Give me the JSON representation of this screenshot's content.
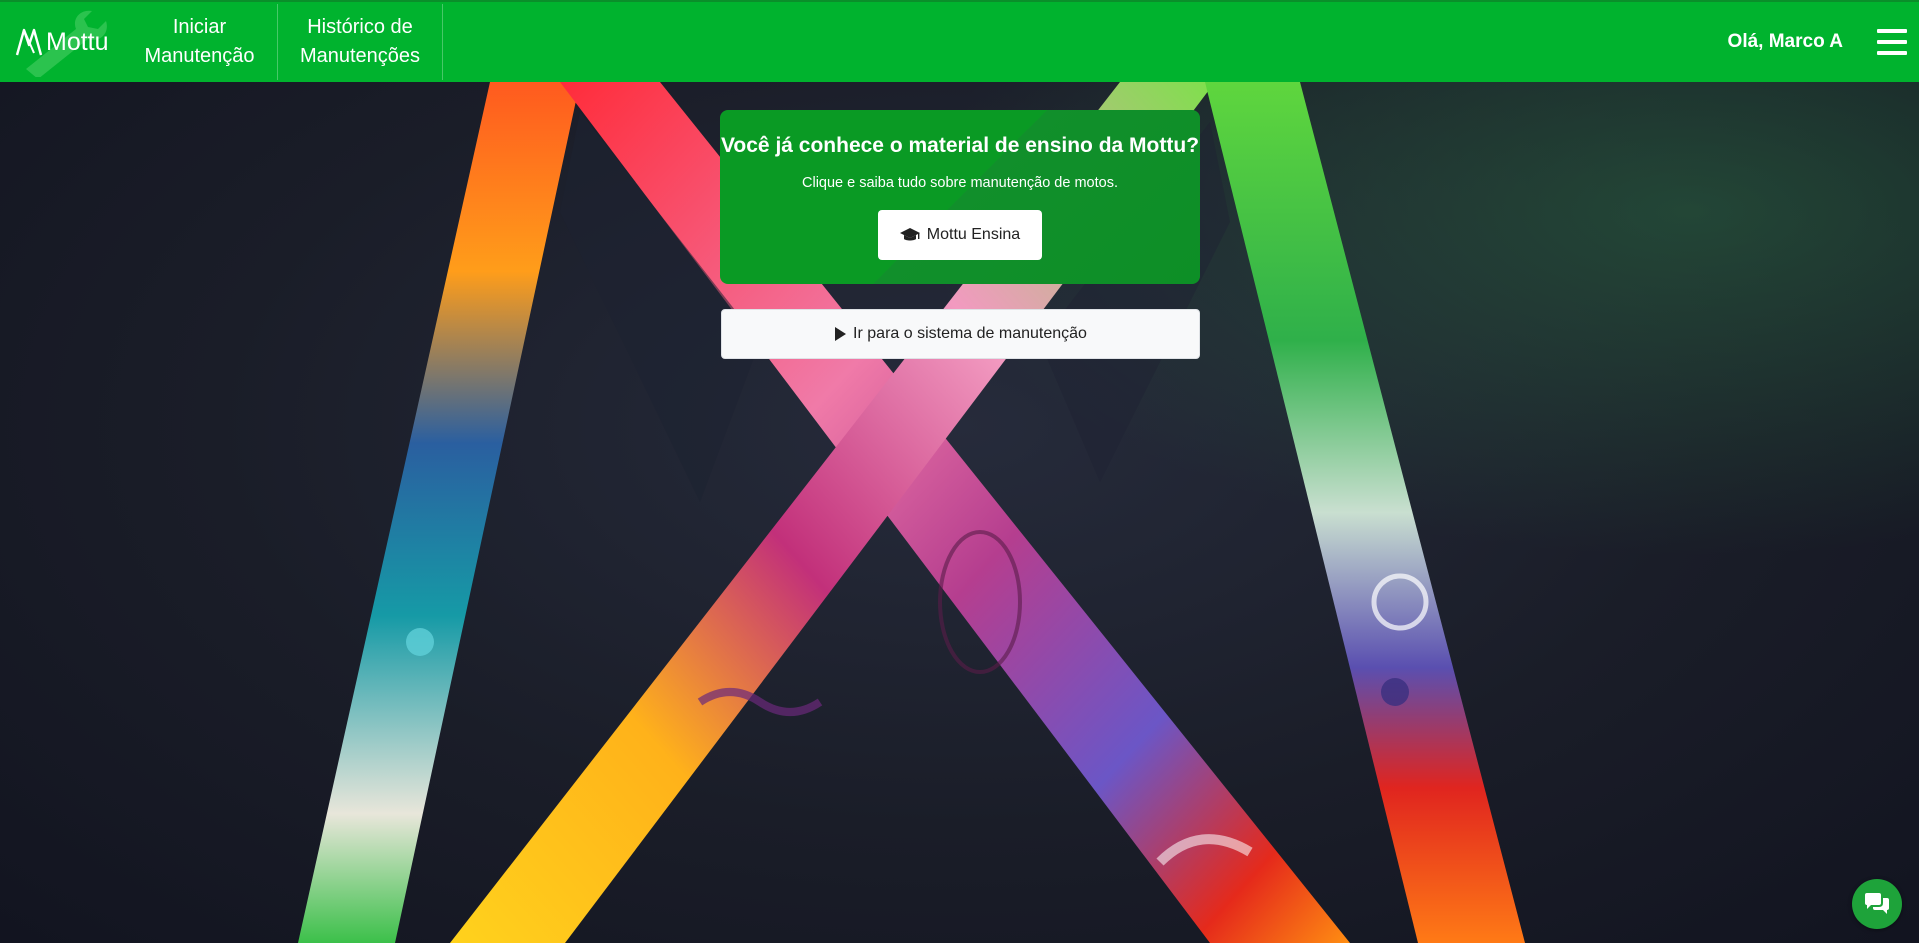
{
  "navbar": {
    "brand_name": "Mottu",
    "links": [
      {
        "label": "Iniciar\nManutenção"
      },
      {
        "label": "Histórico de\nManutenções"
      }
    ],
    "greeting": "Olá, Marco A",
    "menu_icon": "hamburger-menu-icon"
  },
  "promo": {
    "title": "Você já conhece o material de ensino da Mottu?",
    "subtitle": "Clique e saiba tudo sobre manutenção de motos.",
    "button_label": "Mottu Ensina",
    "button_icon": "graduation-cap-icon"
  },
  "system_button": {
    "label": "Ir para o sistema de manutenção",
    "icon": "play-icon"
  },
  "chat_button": {
    "icon": "chat-bubbles-icon"
  },
  "colors": {
    "navbar_bg": "#00b32e",
    "promo_bg": "#0a9a24",
    "chat_bg": "#1ea33a"
  }
}
